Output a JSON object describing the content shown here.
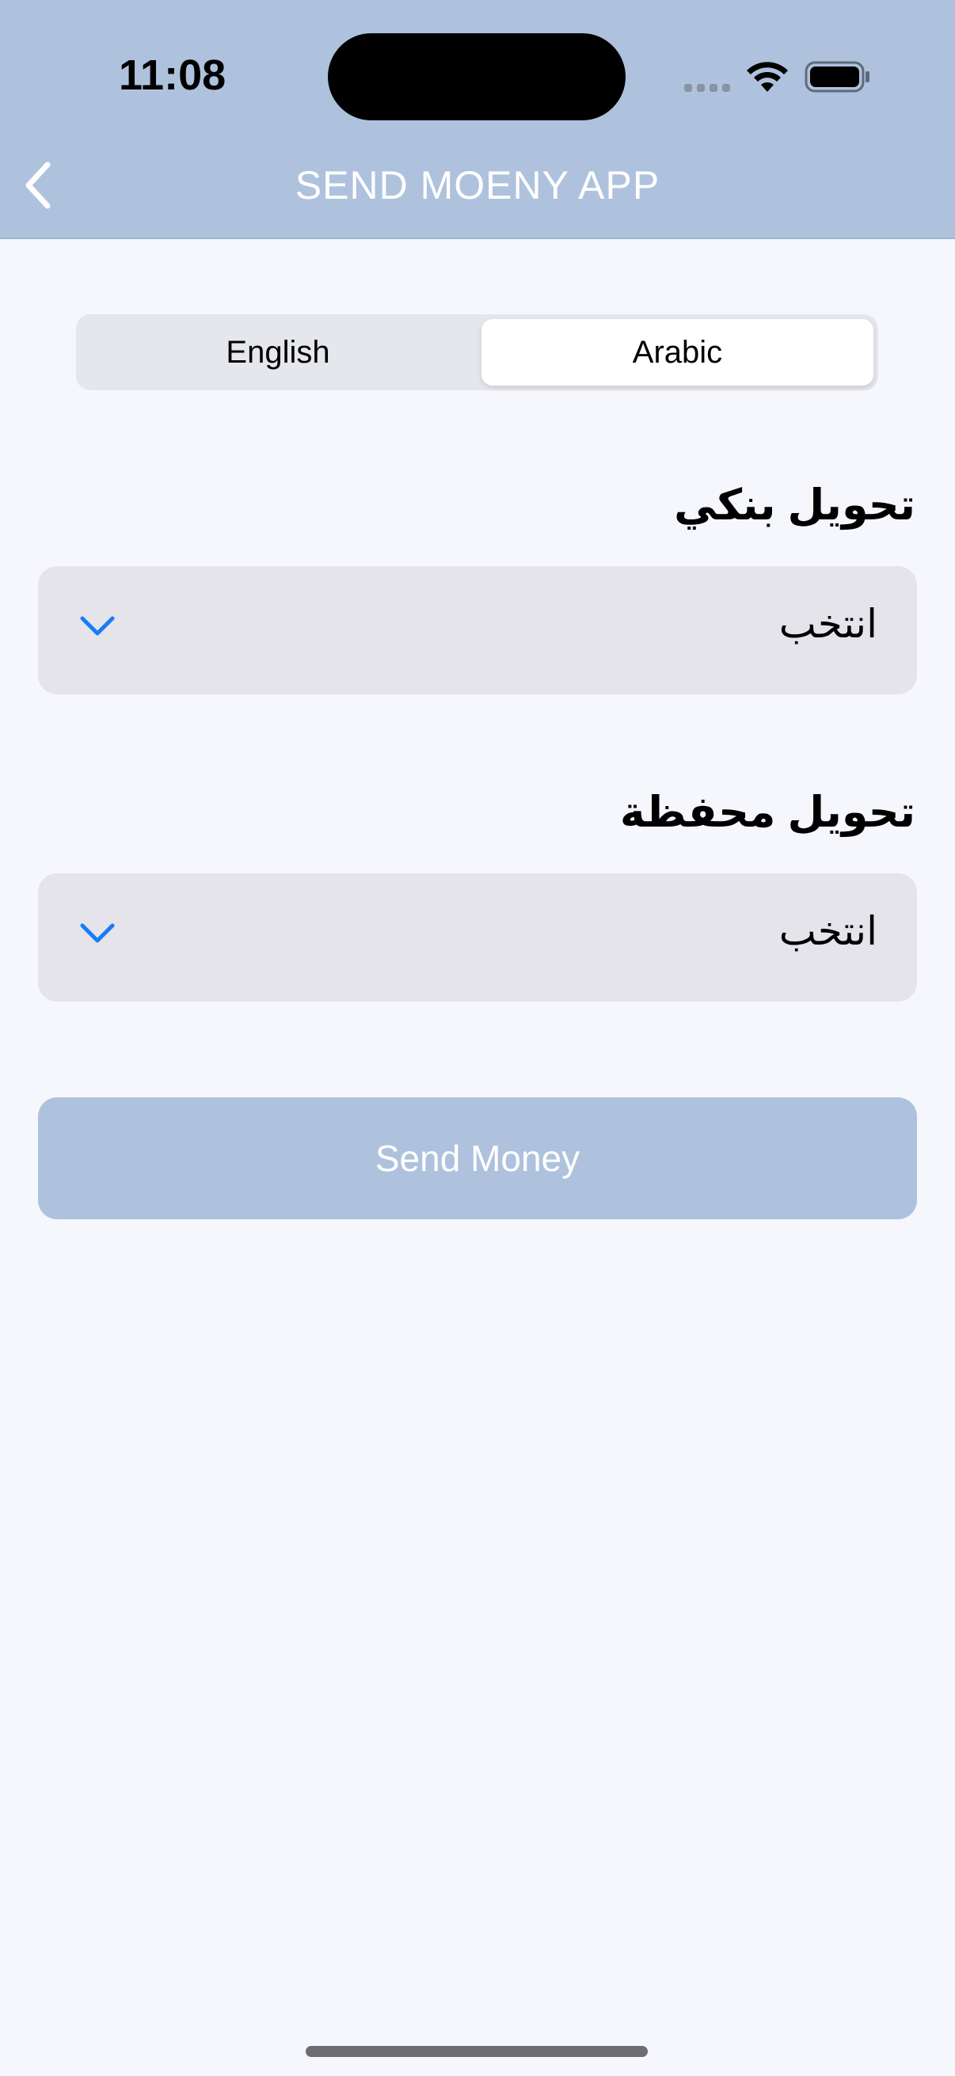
{
  "status_bar": {
    "time": "11:08"
  },
  "nav": {
    "title": "SEND MOENY APP",
    "back_icon": "chevron-left-icon"
  },
  "language_toggle": {
    "options": [
      "English",
      "Arabic"
    ],
    "selected": "Arabic"
  },
  "bank_transfer": {
    "title": "تحويل بنكي",
    "value": "انتخب",
    "icon": "chevron-down-icon"
  },
  "wallet_transfer": {
    "title": "تحويل محفظة",
    "value": "انتخب",
    "icon": "chevron-down-icon"
  },
  "send_button": {
    "label": "Send Money"
  },
  "colors": {
    "header": "#aec2dd",
    "background": "#f6f7fc",
    "accent_blue": "#1a7cf5",
    "field": "#e4e4ea"
  }
}
